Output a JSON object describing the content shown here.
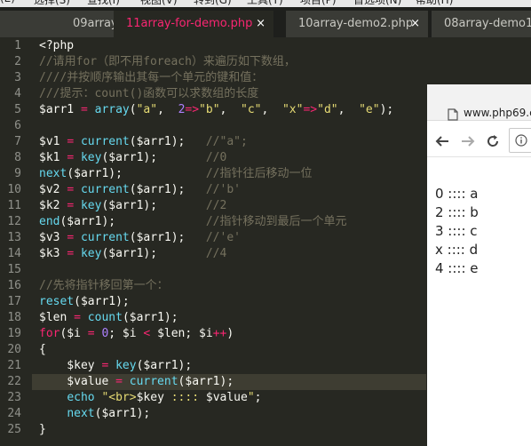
{
  "tabs": [
    {
      "label": "09array-",
      "active": false
    },
    {
      "label": "11array-for-demo.php",
      "active": true,
      "close": "×"
    },
    {
      "label": "10array-demo2.php",
      "active": false,
      "close": "×"
    },
    {
      "label": "08array-demo1.ph",
      "active": false
    }
  ],
  "editor": {
    "line_numbers": [
      "1",
      "2",
      "3",
      "4",
      "5",
      "6",
      "7",
      "8",
      "9",
      "10",
      "11",
      "12",
      "13",
      "14",
      "15",
      "16",
      "17",
      "18",
      "19",
      "20",
      "21",
      "22",
      "23",
      "24",
      "25"
    ],
    "current_line": 22,
    "colors": {
      "background": "#272822",
      "keyword": "#f92672",
      "function": "#66d9ef",
      "string": "#e6db74",
      "number": "#ae81ff",
      "comment": "#75715e"
    }
  },
  "browser": {
    "url": "www.php69.c",
    "nav": {
      "back_icon": "arrow-left-icon",
      "forward_icon": "arrow-right-icon",
      "reload_icon": "reload-icon",
      "info_icon": "info-icon"
    },
    "output": [
      "0 :::: a",
      "2 :::: b",
      "3 :::: c",
      "x :::: d",
      "4 :::: e"
    ]
  }
}
